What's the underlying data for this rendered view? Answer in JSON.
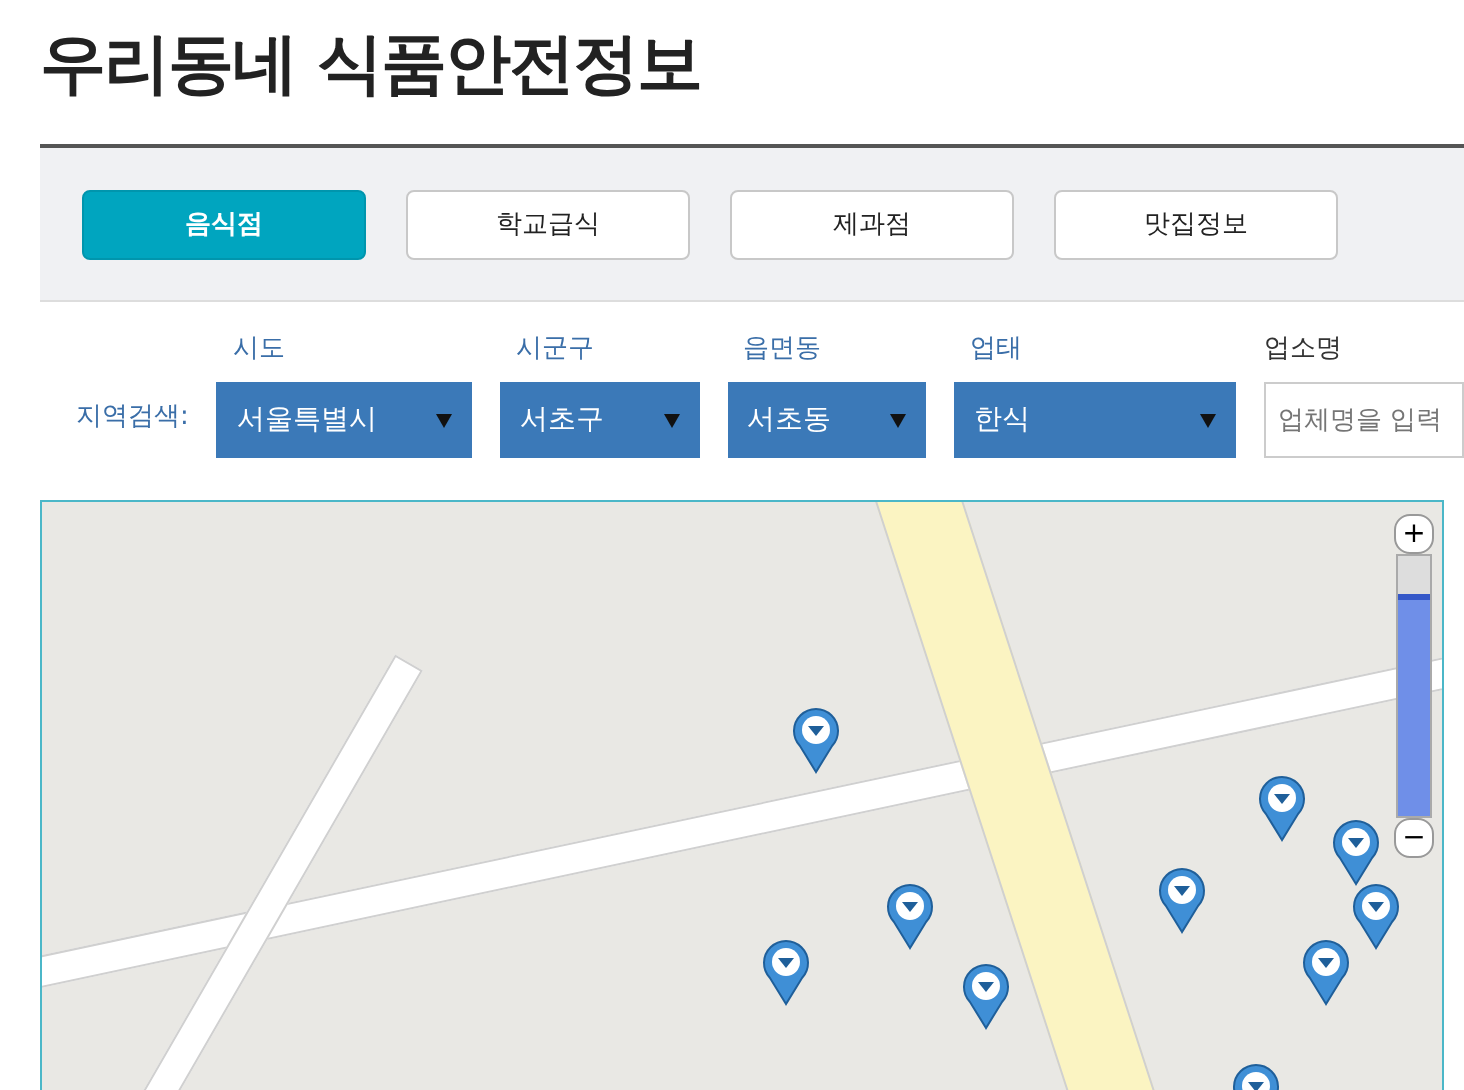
{
  "title": "우리동네 식품안전정보",
  "categories": [
    {
      "label": "음식점",
      "selected": true
    },
    {
      "label": "학교급식",
      "selected": false
    },
    {
      "label": "제과점",
      "selected": false
    },
    {
      "label": "맛집정보",
      "selected": false
    }
  ],
  "search": {
    "label": "지역검색:",
    "filters": [
      {
        "label": "시도",
        "value": "서울특별시"
      },
      {
        "label": "시군구",
        "value": "서초구"
      },
      {
        "label": "읍면동",
        "value": "서초동"
      },
      {
        "label": "업태",
        "value": "한식"
      }
    ],
    "name_field": {
      "label": "업소명",
      "placeholder": "업체명을 입력"
    }
  },
  "map": {
    "zoom": {
      "plus": "+",
      "minus": "−",
      "level": 0.83
    }
  }
}
